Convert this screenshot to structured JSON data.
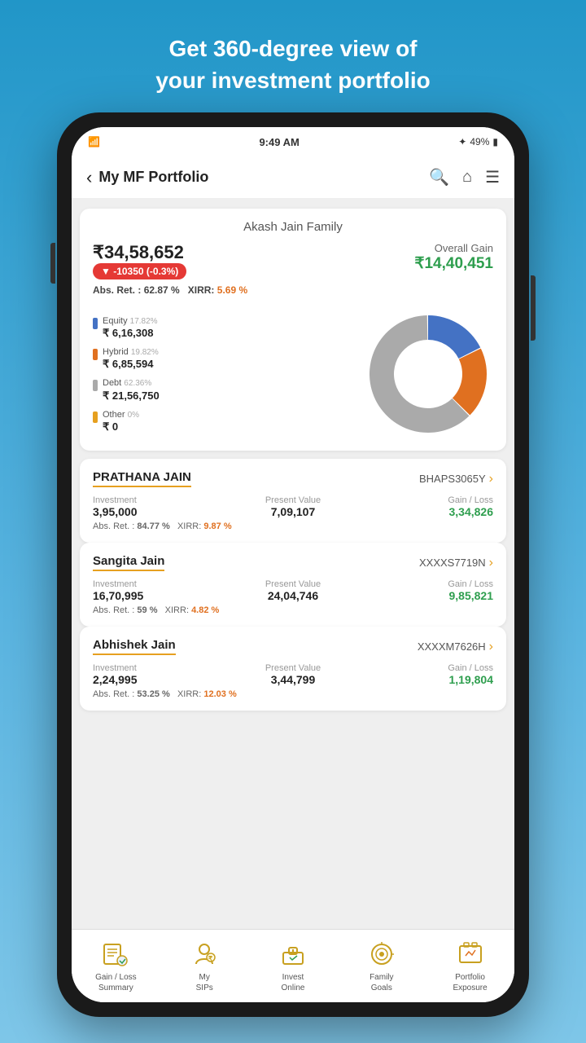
{
  "header": {
    "line1": "Get 360-degree view of",
    "line2": "your investment portfolio"
  },
  "status_bar": {
    "time": "9:49 AM",
    "battery": "49%",
    "bluetooth": "BT"
  },
  "nav": {
    "back_label": "‹",
    "title": "My MF Portfolio"
  },
  "portfolio": {
    "family_name": "Akash Jain Family",
    "total_value": "₹34,58,652",
    "change_badge": "▼ -10350  (-0.3%)",
    "overall_gain_label": "Overall Gain",
    "overall_gain_value": "₹14,40,451",
    "abs_ret_label": "Abs. Ret. :",
    "abs_ret_value": "62.87 %",
    "xirr_label": "XIRR:",
    "xirr_value": "5.69 %",
    "categories": [
      {
        "name": "Equity",
        "percent": "17.82%",
        "amount": "₹ 6,16,308",
        "color": "#4472c4"
      },
      {
        "name": "Hybrid",
        "percent": "19.82%",
        "amount": "₹ 6,85,594",
        "color": "#e07020"
      },
      {
        "name": "Debt",
        "percent": "62.36%",
        "amount": "₹ 21,56,750",
        "color": "#aaaaaa"
      },
      {
        "name": "Other",
        "percent": "0%",
        "amount": "₹ 0",
        "color": "#e6a020"
      }
    ],
    "donut": {
      "segments": [
        {
          "label": "Equity",
          "value": 17.82,
          "color": "#4472c4"
        },
        {
          "label": "Hybrid",
          "value": 19.82,
          "color": "#e07020"
        },
        {
          "label": "Debt",
          "value": 62.36,
          "color": "#aaaaaa"
        }
      ]
    }
  },
  "members": [
    {
      "name": "PRATHANA JAIN",
      "pan": "BHAPS3065Y",
      "investment_label": "Investment",
      "investment": "3,95,000",
      "present_value_label": "Present Value",
      "present_value": "7,09,107",
      "gain_loss_label": "Gain / Loss",
      "gain_loss": "3,34,826",
      "abs_ret": "84.77 %",
      "xirr": "9.87 %"
    },
    {
      "name": "Sangita Jain",
      "pan": "XXXXS7719N",
      "investment_label": "Investment",
      "investment": "16,70,995",
      "present_value_label": "Present Value",
      "present_value": "24,04,746",
      "gain_loss_label": "Gain / Loss",
      "gain_loss": "9,85,821",
      "abs_ret": "59 %",
      "xirr": "4.82 %"
    },
    {
      "name": "Abhishek Jain",
      "pan": "XXXXM7626H",
      "investment_label": "Investment",
      "investment": "2,24,995",
      "present_value_label": "Present Value",
      "present_value": "3,44,799",
      "gain_loss_label": "Gain / Loss",
      "gain_loss": "1,19,804",
      "abs_ret": "53.25 %",
      "xirr": "12.03 %"
    }
  ],
  "bottom_nav": [
    {
      "id": "gain-loss",
      "label": "Gain / Loss\nSummary",
      "icon": "gain-loss-icon"
    },
    {
      "id": "my-sips",
      "label": "My\nSIPs",
      "icon": "sips-icon"
    },
    {
      "id": "invest-online",
      "label": "Invest\nOnline",
      "icon": "invest-icon"
    },
    {
      "id": "family-goals",
      "label": "Family\nGoals",
      "icon": "goals-icon"
    },
    {
      "id": "portfolio-exposure",
      "label": "Portfolio\nExposure",
      "icon": "exposure-icon"
    }
  ]
}
